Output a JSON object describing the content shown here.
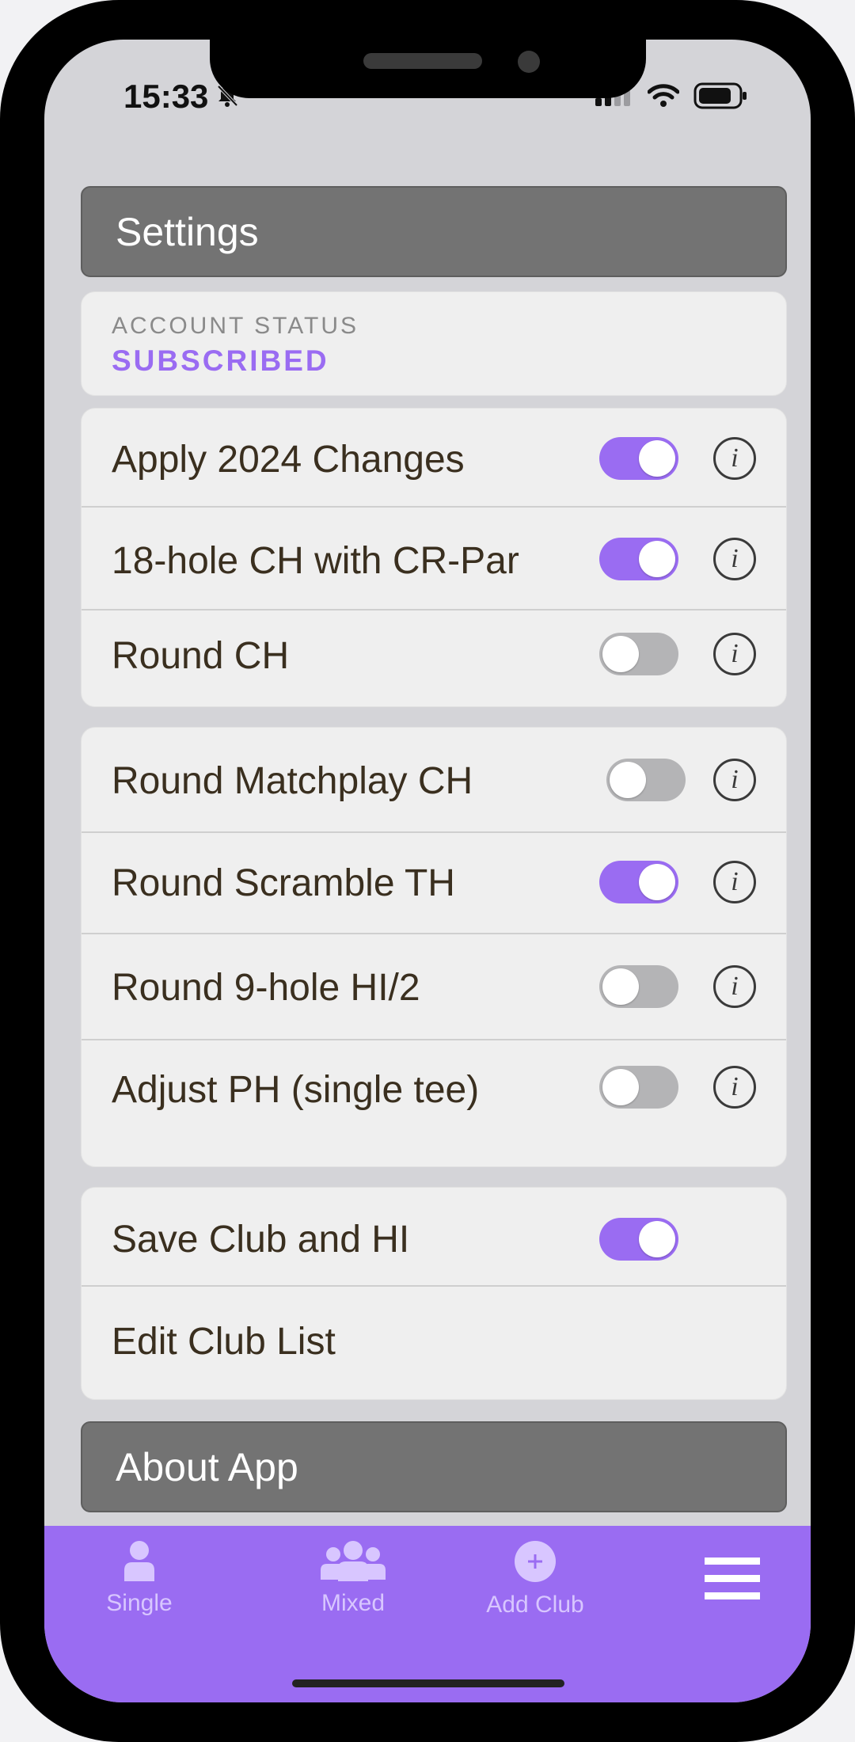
{
  "status": {
    "time": "15:33"
  },
  "header_settings": "Settings",
  "account": {
    "title": "ACCOUNT STATUS",
    "value": "SUBSCRIBED"
  },
  "group1": [
    {
      "label": "Apply 2024 Changes",
      "on": true,
      "info": true
    },
    {
      "label": "18-hole CH with CR-Par",
      "on": true,
      "info": true
    },
    {
      "label": "Round CH",
      "on": false,
      "info": true
    }
  ],
  "group2": [
    {
      "label": "Round Matchplay CH",
      "on": false,
      "info": true
    },
    {
      "label": "Round Scramble TH",
      "on": true,
      "info": true
    },
    {
      "label": "Round 9-hole HI/2",
      "on": false,
      "info": true
    },
    {
      "label": "Adjust PH (single tee)",
      "on": false,
      "info": true
    }
  ],
  "group3": [
    {
      "label": "Save Club and HI",
      "on": true
    },
    {
      "label": "Edit Club List"
    }
  ],
  "header_about": "About App",
  "tabs": [
    {
      "label": "Single",
      "icon": "person-icon"
    },
    {
      "label": "Mixed",
      "icon": "group-icon"
    },
    {
      "label": "Add Club",
      "icon": "add-circle-icon"
    },
    {
      "label": "",
      "icon": "menu-icon"
    }
  ],
  "info_glyph": "i",
  "colors": {
    "accent": "#9a6cf2",
    "header": "#737373",
    "tab_text": "#d8c6ff"
  }
}
